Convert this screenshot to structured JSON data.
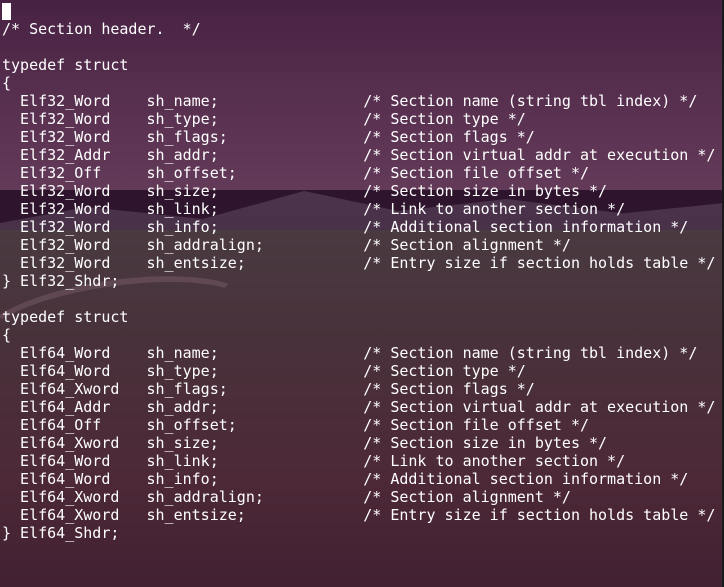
{
  "terminal": {
    "lines": [
      "/* Section header.  */",
      "",
      "typedef struct",
      "{",
      "  Elf32_Word    sh_name;                /* Section name (string tbl index) */",
      "  Elf32_Word    sh_type;                /* Section type */",
      "  Elf32_Word    sh_flags;               /* Section flags */",
      "  Elf32_Addr    sh_addr;                /* Section virtual addr at execution */",
      "  Elf32_Off     sh_offset;              /* Section file offset */",
      "  Elf32_Word    sh_size;                /* Section size in bytes */",
      "  Elf32_Word    sh_link;                /* Link to another section */",
      "  Elf32_Word    sh_info;                /* Additional section information */",
      "  Elf32_Word    sh_addralign;           /* Section alignment */",
      "  Elf32_Word    sh_entsize;             /* Entry size if section holds table */",
      "} Elf32_Shdr;",
      "",
      "typedef struct",
      "{",
      "  Elf64_Word    sh_name;                /* Section name (string tbl index) */",
      "  Elf64_Word    sh_type;                /* Section type */",
      "  Elf64_Xword   sh_flags;               /* Section flags */",
      "  Elf64_Addr    sh_addr;                /* Section virtual addr at execution */",
      "  Elf64_Off     sh_offset;              /* Section file offset */",
      "  Elf64_Xword   sh_size;                /* Section size in bytes */",
      "  Elf64_Word    sh_link;                /* Link to another section */",
      "  Elf64_Word    sh_info;                /* Additional section information */",
      "  Elf64_Xword   sh_addralign;           /* Section alignment */",
      "  Elf64_Xword   sh_entsize;             /* Entry size if section holds table */",
      "} Elf64_Shdr;"
    ]
  },
  "colors": {
    "text": "#ffffff",
    "tint": "#46143c"
  }
}
